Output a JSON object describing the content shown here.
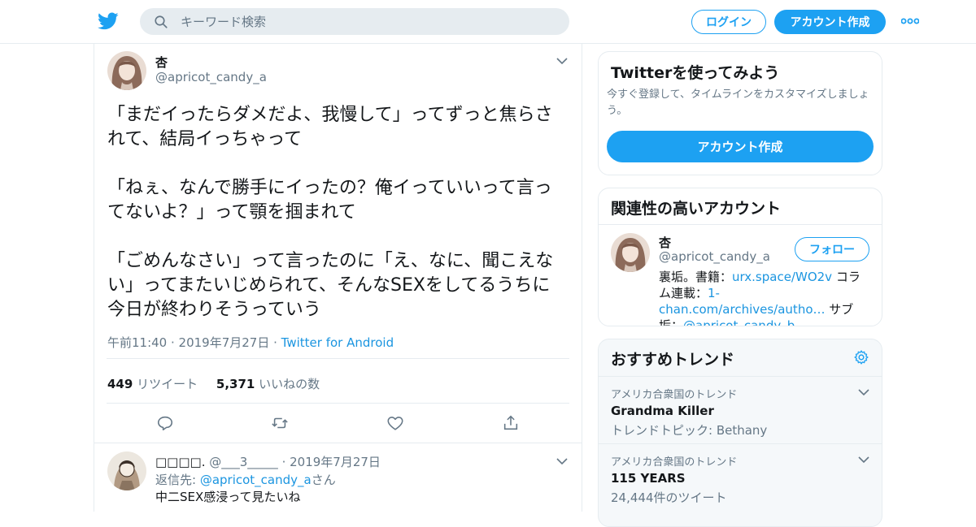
{
  "header": {
    "search_placeholder": "キーワード検索",
    "login_label": "ログイン",
    "signup_label": "アカウント作成"
  },
  "tweet": {
    "name": "杏",
    "handle": "@apricot_candy_a",
    "text": "「まだイったらダメだよ、我慢して」ってずっと焦らされて、結局イっちゃって\n\n「ねぇ、なんで勝手にイったの？俺イっていいって言ってないよ？」って顎を掴まれて\n\n「ごめんなさい」って言ったのに「え、なに、聞こえない」ってまたいじめられて、そんなSEXをしてるうちに今日が終わりそうっていう",
    "timestamp": "午前11:40 · 2019年7月27日",
    "separator": " · ",
    "source": "Twitter for Android",
    "retweet_count": "449",
    "retweet_label": "リツイート",
    "like_count": "5,371",
    "like_label": "いいねの数"
  },
  "reply": {
    "name": "□□□□.",
    "handle": "@___3_____",
    "date": "· 2019年7月27日",
    "to_label": "返信先: ",
    "to_handle": "@apricot_candy_a",
    "to_suffix": "さん",
    "text": "中二SEX感浸って見たいね"
  },
  "sidebar": {
    "signup_card": {
      "title": "Twitterを使ってみよう",
      "description": "今すぐ登録して、タイムラインをカスタマイズしましょう。",
      "button": "アカウント作成"
    },
    "related": {
      "title": "関連性の高いアカウント",
      "name": "杏",
      "handle": "@apricot_candy_a",
      "follow": "フォロー",
      "bio_1": "裏垢。書籍：",
      "bio_link_1": "urx.space/WO2v",
      "bio_2": " コラム連載：",
      "bio_link_2": "1-chan.com/archives/autho…",
      "bio_3": " サブ垢：",
      "bio_link_3": "@apricot_candy_b"
    },
    "trends": {
      "title": "おすすめトレンド",
      "items": [
        {
          "location": "アメリカ合衆国のトレンド",
          "name": "Grandma Killer",
          "sub": "トレンドトピック: Bethany"
        },
        {
          "location": "アメリカ合衆国のトレンド",
          "name": "115 YEARS",
          "sub": "24,444件のツイート"
        }
      ]
    }
  },
  "colors": {
    "accent": "#1da1f2",
    "link": "#1b95e0",
    "muted": "#657786",
    "text": "#14171a",
    "border": "#e6ecf0"
  },
  "icons": [
    "twitter-bird-icon",
    "search-icon",
    "more-dots-icon",
    "chevron-down-icon",
    "reply-icon",
    "retweet-icon",
    "like-icon",
    "share-icon",
    "gear-icon"
  ]
}
